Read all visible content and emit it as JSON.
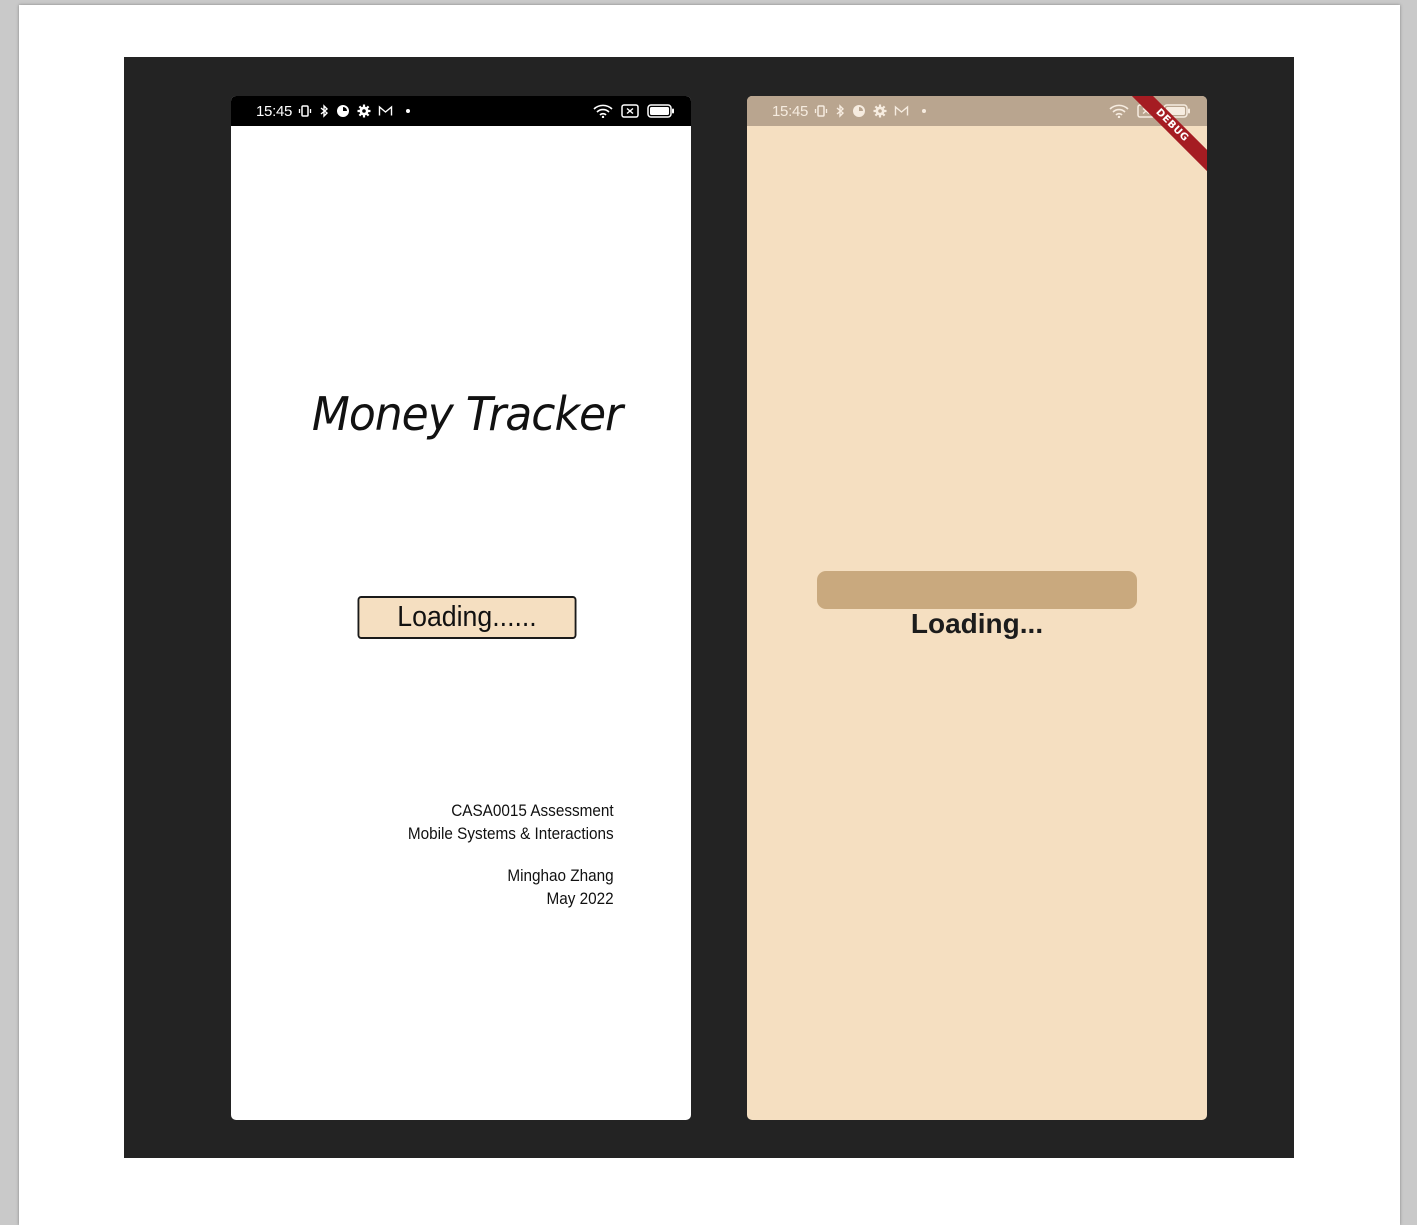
{
  "left_screen": {
    "status_time": "15:45",
    "status_icons": [
      "vibrate-icon",
      "bluetooth-icon",
      "app-icon",
      "settings-icon",
      "gmail-icon",
      "dot"
    ],
    "status_right_icons": [
      "wifi-icon",
      "sim-icon",
      "battery-icon"
    ],
    "app_title": "Money Tracker",
    "loading_label": "Loading......",
    "credits": {
      "line1": "CASA0015 Assessment",
      "line2": "Mobile Systems & Interactions",
      "author": "Minghao Zhang",
      "date": "May 2022"
    }
  },
  "right_screen": {
    "status_time": "15:45",
    "loading_label": "Loading...",
    "progress_fraction": 1.0,
    "debug_label": "DEBUG"
  },
  "colors": {
    "stage": "#232323",
    "beige": "#f5dfc1",
    "progress": "#c9a97e",
    "right_statusbar": "#b9a58f",
    "debug_banner": "#a51c22"
  }
}
